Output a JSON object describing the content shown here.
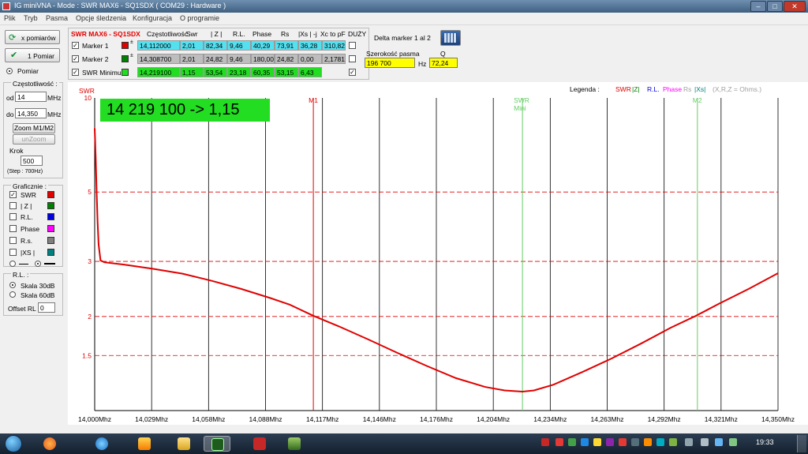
{
  "window": {
    "title": "IG miniVNA - Mode : SWR MAX6 - SQ1SDX ( COM29 : Hardware )",
    "buttons": [
      "–",
      "□",
      "✕"
    ]
  },
  "menu": [
    "Plik",
    "Tryb",
    "Pasma",
    "Opcje śledzenia",
    "Konfiguracja",
    "O programie"
  ],
  "left_panel": {
    "x_pomiarow_label": "x pomiarów",
    "one_measure_label": "1 Pomiar",
    "pomiar_label": "Pomiar",
    "freq_group_label": "Częstotliwość :",
    "od_label": "od",
    "od_value": "14",
    "od_unit": "MHz",
    "do_label": "do",
    "do_value": "14,350",
    "do_unit": "MHz",
    "zoom_label": "Zoom M1/M2",
    "unzoom_label": "unZoom",
    "krok_label": "Krok",
    "krok_value": "500",
    "step_label": "(Step : 700Hz)",
    "graphics_label": "Graficznie :",
    "graphics": [
      {
        "label": "SWR",
        "checked": true,
        "color": "#e00000"
      },
      {
        "label": "| Z |",
        "checked": false,
        "color": "#008000"
      },
      {
        "label": "R.L.",
        "checked": false,
        "color": "#0000e0"
      },
      {
        "label": "Phase",
        "checked": false,
        "color": "#ff00ff"
      },
      {
        "label": "R.s.",
        "checked": false,
        "color": "#808080"
      },
      {
        "label": "|XS |",
        "checked": false,
        "color": "#008080"
      }
    ],
    "rl_group_label": "R.L. :",
    "skala30": "Skala 30dB",
    "skala60": "Skala 60dB",
    "offset_label": "Offset RL",
    "offset_value": "0"
  },
  "marker_table": {
    "device_label": "SWR MAX6 - SQ1SDX",
    "headers": [
      "Częstotliwość",
      "Swr",
      "| Z |",
      "R.L.",
      "Phase",
      "Rs",
      "|Xs | -j",
      "Xc to pF",
      "DUŻY"
    ],
    "rows": [
      {
        "name": "Marker 1",
        "color": "#e00000",
        "bg": "#55e0f0",
        "values": [
          "14,112000",
          "2,01",
          "82,34",
          "9,46",
          "40,29",
          "73,91",
          "36,28",
          "310,82"
        ]
      },
      {
        "name": "Marker 2",
        "color": "#008000",
        "bg": "#bdbdbd",
        "values": [
          "14,308700",
          "2,01",
          "24,82",
          "9,46",
          "180,00",
          "24,82",
          "0,00",
          "2,1781"
        ]
      },
      {
        "name": "SWR Minimu",
        "color": "#22dd22",
        "bg": "#22dd22",
        "values": [
          "14,219100",
          "1,15",
          "53,54",
          "23,18",
          "60,35",
          "53,15",
          "6,43"
        ]
      }
    ],
    "delta_label": "Delta marker 1 al 2",
    "bandwidth_label": "Szerokość pasma",
    "bandwidth_value": "196 700",
    "hz_label": "Hz",
    "q_label": "Q",
    "q_value": "72,24"
  },
  "legend": {
    "label": "Legenda :",
    "swr": "SWR",
    "z": "|Z|",
    "rl": "R.L.",
    "phase": "Phase",
    "rs": "Rs",
    "xs": "|Xs|",
    "units": "(X,R,Z = Ohms.)"
  },
  "readout": "14 219 100 -> 1,15",
  "chart_data": {
    "type": "line",
    "ylabel": "SWR",
    "y_scale": "log",
    "ylim": [
      1,
      10
    ],
    "y_ticks": [
      10,
      5,
      3,
      2,
      1.5
    ],
    "xlim": [
      14.0,
      14.35
    ],
    "x_ticks": [
      "14,000Mhz",
      "14,029Mhz",
      "14,058Mhz",
      "14,088Mhz",
      "14,117Mhz",
      "14,146Mhz",
      "14,176Mhz",
      "14,204Mhz",
      "14,234Mhz",
      "14,263Mhz",
      "14,292Mhz",
      "14,321Mhz",
      "14,350Mhz"
    ],
    "markers": [
      {
        "label": "M1",
        "x": 14.112,
        "color": "#e00000"
      },
      {
        "label": "SWR\nMini",
        "x": 14.2191,
        "color": "#66cc66"
      },
      {
        "label": "M2",
        "x": 14.3087,
        "color": "#66cc66"
      }
    ],
    "series": [
      {
        "color": "#e00000",
        "x": [
          14.0,
          14.0005,
          14.001,
          14.0015,
          14.002,
          14.003,
          14.005,
          14.015,
          14.03,
          14.045,
          14.06,
          14.075,
          14.09,
          14.1,
          14.112,
          14.125,
          14.14,
          14.155,
          14.17,
          14.185,
          14.2,
          14.21,
          14.2191,
          14.225,
          14.235,
          14.25,
          14.265,
          14.28,
          14.295,
          14.308,
          14.32,
          14.335,
          14.35
        ],
        "y": [
          8.0,
          6.5,
          5.0,
          4.0,
          3.4,
          3.02,
          2.98,
          2.93,
          2.84,
          2.74,
          2.6,
          2.45,
          2.29,
          2.18,
          2.01,
          1.86,
          1.69,
          1.53,
          1.39,
          1.27,
          1.19,
          1.16,
          1.15,
          1.16,
          1.21,
          1.33,
          1.47,
          1.64,
          1.84,
          2.01,
          2.2,
          2.45,
          2.75
        ]
      }
    ]
  }
}
